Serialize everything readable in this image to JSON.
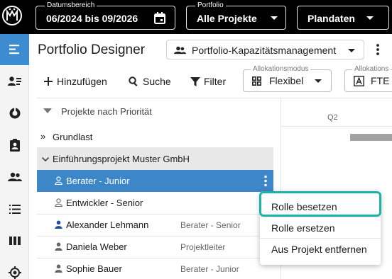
{
  "topbar": {
    "date_range": {
      "label": "Datumsbereich",
      "value": "06/2024 bis 09/2026"
    },
    "portfolio": {
      "label": "Portfolio",
      "value": "Alle Projekte"
    },
    "plan": {
      "value": "Plandaten"
    }
  },
  "sidebar": {
    "items": [
      {
        "icon": "menu-lines-icon",
        "active": true
      },
      {
        "icon": "person-list-icon"
      },
      {
        "icon": "donut-chart-icon"
      },
      {
        "icon": "clipboard-person-icon"
      },
      {
        "icon": "people-icon"
      },
      {
        "icon": "list-icon"
      },
      {
        "icon": "columns-icon"
      },
      {
        "icon": "target-icon"
      }
    ]
  },
  "header": {
    "title": "Portfolio Designer",
    "view": "Portfolio-Kapazitätsmanagement"
  },
  "toolbar": {
    "add": "Hinzufügen",
    "search": "Suche",
    "filter": "Filter",
    "alloc_mode": {
      "label": "Allokationsmodus",
      "value": "Flexibel"
    },
    "alloc_unit": {
      "label": "Allokations",
      "value": "FTE"
    }
  },
  "timeline": {
    "quarter": "Q2"
  },
  "tree": {
    "header": "Projekte nach Priorität",
    "rows": [
      {
        "name": "Grundlast",
        "role": ""
      },
      {
        "name": "Einführungsprojekt Muster GmbH",
        "role": ""
      },
      {
        "name": "Berater - Junior",
        "role": ""
      },
      {
        "name": "Entwickler - Senior",
        "role": ""
      },
      {
        "name": "Alexander Lehmann",
        "role": "Berater - Senior"
      },
      {
        "name": "Daniela Weber",
        "role": "Projektleiter"
      },
      {
        "name": "Sophie Bauer",
        "role": "Berater - Junior"
      }
    ]
  },
  "context_menu": {
    "items": [
      "Rolle besetzen",
      "Rolle ersetzen",
      "Aus Projekt entfernen"
    ]
  },
  "colors": {
    "accent": "#3d87c8",
    "highlight": "#1ab4a6",
    "topbar": "#000000"
  }
}
